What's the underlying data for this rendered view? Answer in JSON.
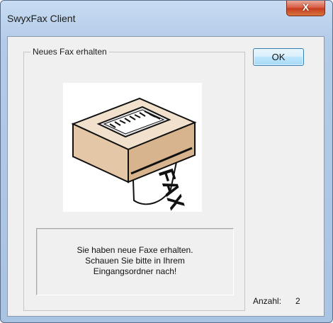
{
  "window": {
    "title": "SwyxFax Client",
    "close_icon": "close-icon"
  },
  "group": {
    "label": "Neues Fax erhalten",
    "image_icon": "fax-machine-icon",
    "image_text": "FAX"
  },
  "message": {
    "text": "Sie haben neue Faxe erhalten.\nSchauen Sie bitte in Ihrem\nEingangsordner nach!"
  },
  "buttons": {
    "ok_label": "OK",
    "close_label": "X"
  },
  "count": {
    "label": "Anzahl:",
    "value": "2"
  },
  "colors": {
    "frame": "#b2cbe8",
    "close": "#c43b1e",
    "ok_border": "#3c7fb1"
  }
}
